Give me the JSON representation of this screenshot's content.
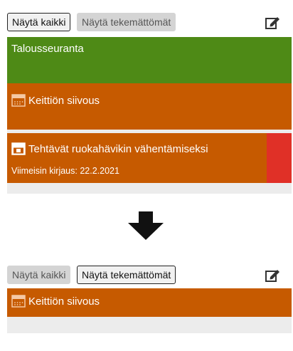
{
  "top": {
    "show_all_label": "Näytä kaikki",
    "show_undone_label": "Näytä tekemättömät",
    "active": "show_all",
    "items": [
      {
        "title": "Talousseuranta",
        "color": "#4e8a16",
        "icon": ""
      },
      {
        "title": "Keittiön siivous",
        "color": "#c65a00",
        "icon": "calendar-icon"
      },
      {
        "title": "Tehtävät ruokahävikin vähentämiseksi",
        "color": "#c65a00",
        "icon": "calendar-check-icon",
        "subtitle": "Viimeisin kirjaus: 22.2.2021",
        "flag_color": "#e03027"
      }
    ]
  },
  "bottom": {
    "show_all_label": "Näytä kaikki",
    "show_undone_label": "Näytä tekemättömät",
    "active": "show_undone",
    "items": [
      {
        "title": "Keittiön siivous",
        "color": "#c65a00",
        "icon": "calendar-icon"
      }
    ]
  },
  "transition_icon": "arrow-down-icon",
  "edit_icon": "edit-icon",
  "colors": {
    "green": "#4e8a16",
    "orange": "#c65a00",
    "red": "#e03027",
    "list_background": "#ececec"
  }
}
